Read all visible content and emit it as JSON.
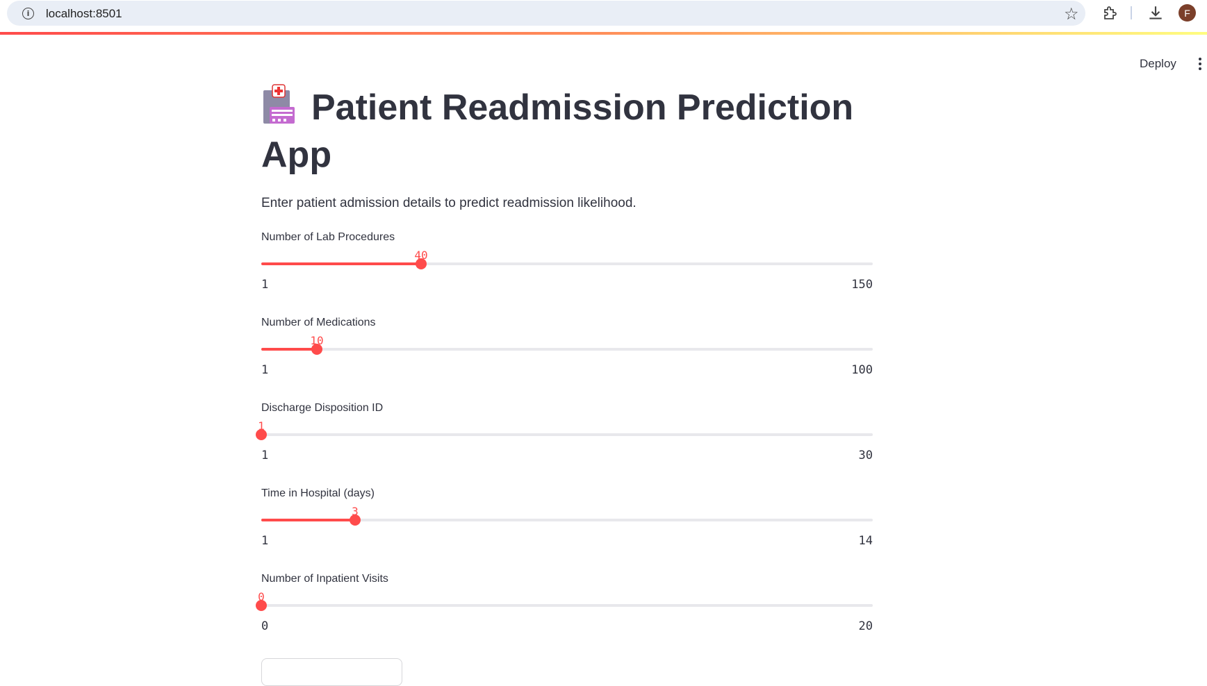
{
  "browser": {
    "url": "localhost:8501",
    "avatar_letter": "F"
  },
  "header": {
    "deploy_label": "Deploy"
  },
  "app": {
    "title": "Patient Readmission Prediction App",
    "subtitle": "Enter patient admission details to predict readmission likelihood."
  },
  "sliders": [
    {
      "label": "Number of Lab Procedures",
      "value": 40,
      "min": 1,
      "max": 150
    },
    {
      "label": "Number of Medications",
      "value": 10,
      "min": 1,
      "max": 100
    },
    {
      "label": "Discharge Disposition ID",
      "value": 1,
      "min": 1,
      "max": 30
    },
    {
      "label": "Time in Hospital (days)",
      "value": 3,
      "min": 1,
      "max": 14
    },
    {
      "label": "Number of Inpatient Visits",
      "value": 0,
      "min": 0,
      "max": 20
    }
  ],
  "colors": {
    "accent": "#ff4b4b",
    "track": "#e8e8ec",
    "text": "#31333f"
  }
}
